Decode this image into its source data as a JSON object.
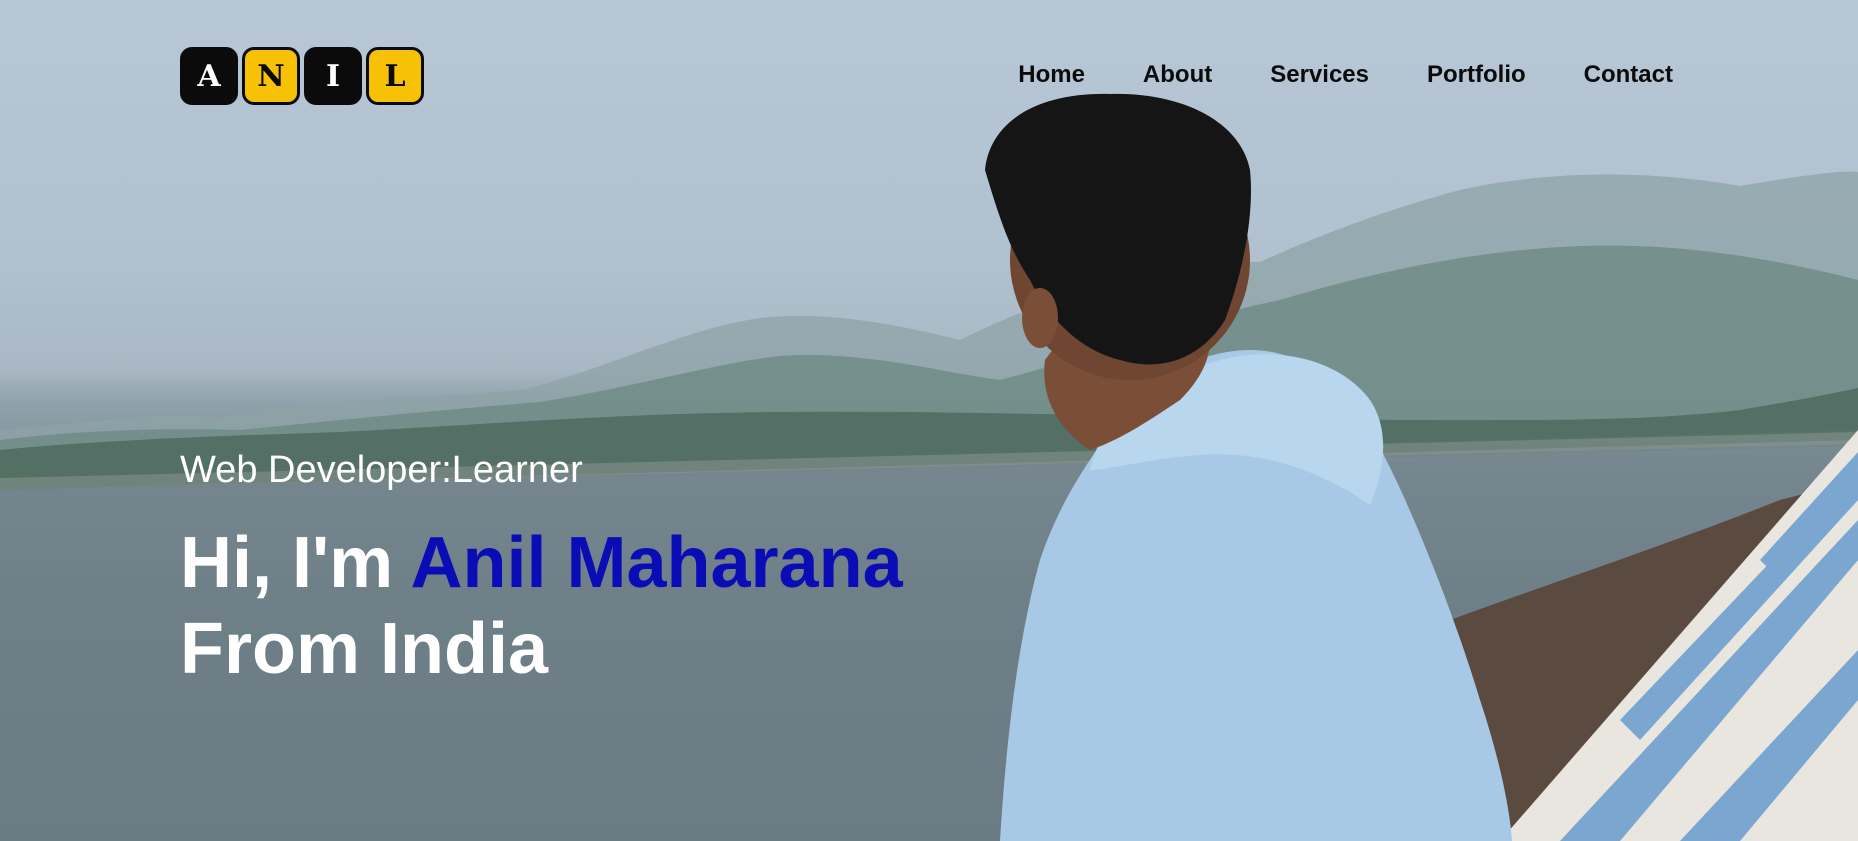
{
  "logo": {
    "letters": [
      "A",
      "N",
      "I",
      "L"
    ],
    "colors": [
      "#0b0b0b",
      "#f7c106"
    ]
  },
  "nav": {
    "items": [
      {
        "label": "Home"
      },
      {
        "label": "About"
      },
      {
        "label": "Services"
      },
      {
        "label": "Portfolio"
      },
      {
        "label": "Contact"
      }
    ]
  },
  "hero": {
    "subtitle": "Web Developer:Learner",
    "greeting": "Hi, I'm",
    "name": "Anil Maharana",
    "location_line": "From India",
    "name_color": "#0a0db5"
  }
}
